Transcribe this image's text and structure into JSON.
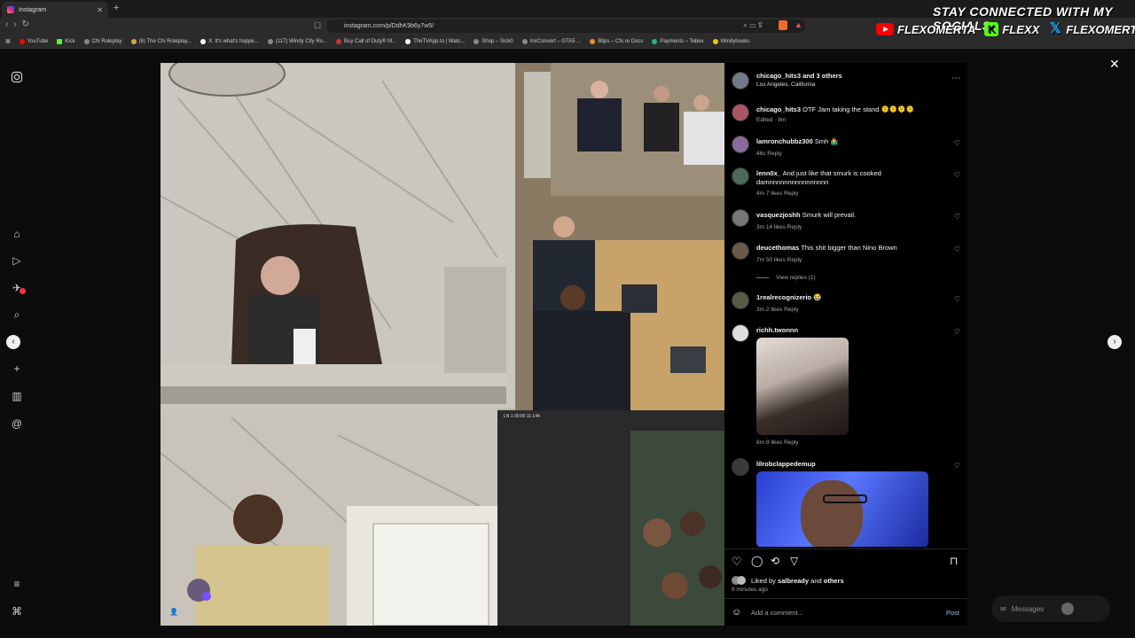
{
  "browser": {
    "tab_title": "Instagram",
    "url": "instagram.com/p/DdhK9b6y7w5/",
    "bookmarks": [
      "YouTube",
      "Kick",
      "Chi Roleplay",
      "(6) The Chi Roleplay...",
      "X. It's what's happe...",
      "(117) Windy City Ro...",
      "Buy Call of Duty® M...",
      "TheTVApp.to | Watc...",
      "Shop – Sick0",
      "InxConvert – GTA5 ...",
      "Blips – Cfx.re Docs",
      "Payments – Tebex",
      "Windybooks"
    ]
  },
  "overlay": {
    "title": "STAY CONNECTED WITH MY SOCIALS",
    "youtube": "FLEXOMERTA",
    "kick": "FLEXX",
    "x": "FLEXOMERTA"
  },
  "post": {
    "author": "chicago_hits3",
    "coauthors": "and 3 others",
    "location": "Los Angeles, California",
    "caption_user": "chicago_hits3",
    "caption": "OTF Jam taking the stand 🫠🫠🫠🫠",
    "caption_meta": "Edited · 8m",
    "liked_by_prefix": "Liked by",
    "liked_by_user": "salbready",
    "liked_by_and": "and",
    "liked_by_others": "others",
    "time_ago": "9 minutes ago",
    "comment_placeholder": "Add a comment...",
    "post_button": "Post",
    "courtroom_overlay_text": "LN 1  00:00 11:144"
  },
  "comments": [
    {
      "user": "lamronchubbz300",
      "text": "Smh 🤷‍♂️",
      "meta": "46s   Reply"
    },
    {
      "user": "lenn0x_",
      "text": "And just like that smurk is cooked damnnnnnnnnnnnnnnnn",
      "meta": "4m   7 likes   Reply"
    },
    {
      "user": "vasquezjoshh",
      "text": "Smurk will prevail.",
      "meta": "3m   14 likes   Reply"
    },
    {
      "user": "deucethomas",
      "text": "This shit bigger than Nino Brown",
      "meta": "7m   50 likes   Reply",
      "replies": "View replies (1)"
    },
    {
      "user": "1realrecognizerio",
      "text": "😂",
      "meta": "3m   2 likes   Reply"
    },
    {
      "user": "richh.twonnn",
      "text": "",
      "meta": "8m   8 likes   Reply"
    },
    {
      "user": "lilrobclappedemup",
      "text": "",
      "meta": ""
    }
  ],
  "messages": {
    "label": "Messages"
  },
  "colors": {
    "panel_bg": "#000000",
    "page_bg": "#0c0c0c",
    "accent_red": "#ff3040"
  }
}
